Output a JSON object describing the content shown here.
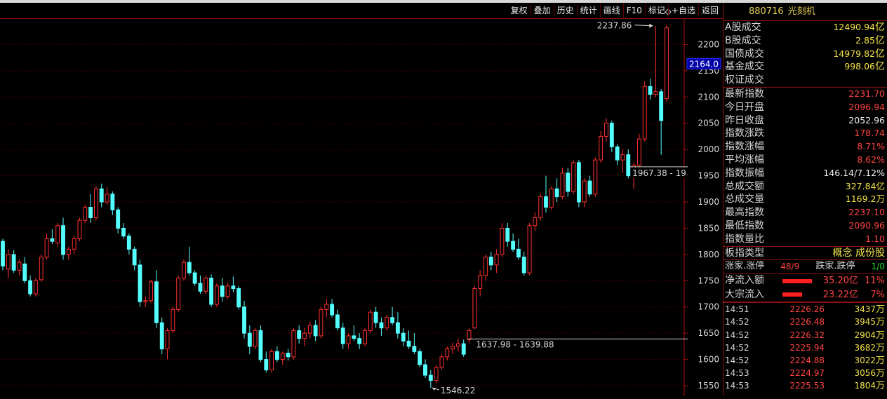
{
  "toolbar": [
    {
      "key": "restore",
      "label": "复权"
    },
    {
      "key": "overlay",
      "label": "叠加"
    },
    {
      "key": "history",
      "label": "历史"
    },
    {
      "key": "stats",
      "label": "统计"
    },
    {
      "key": "draw",
      "label": "画线"
    },
    {
      "key": "f10",
      "label": "F10"
    },
    {
      "key": "mark",
      "label": "标记"
    },
    {
      "key": "watchlist",
      "label": "+自选"
    },
    {
      "key": "back",
      "label": "返回"
    }
  ],
  "axis": {
    "ticks": [
      "2200",
      "2150",
      "2100",
      "2050",
      "2000",
      "1950",
      "1900",
      "1850",
      "1800",
      "1750",
      "1700",
      "1650",
      "1600",
      "1550"
    ],
    "current_price_label": "2164.0"
  },
  "annotations": {
    "high": "2237.86",
    "low": "1546.22",
    "gap_lower": "1637.98 - 1639.88",
    "gap_upper": "1967.38 - 19"
  },
  "colors": {
    "up": "#ff3030",
    "down": "#54ffff",
    "grid": "#7a0000",
    "panel_border": "#8a1010"
  },
  "header": {
    "code": "880716",
    "name": "光刻机"
  },
  "turnover": [
    {
      "label": "A股成交",
      "value": "12490.94",
      "unit": "亿"
    },
    {
      "label": "B股成交",
      "value": "2.85",
      "unit": "亿"
    },
    {
      "label": "国债成交",
      "value": "14979.82",
      "unit": "亿"
    },
    {
      "label": "基金成交",
      "value": "998.06",
      "unit": "亿"
    },
    {
      "label": "权证成交",
      "value": "",
      "unit": ""
    }
  ],
  "stats": [
    {
      "label": "最新指数",
      "value": "2231.70",
      "color": "red"
    },
    {
      "label": "今日开盘",
      "value": "2096.94",
      "color": "red"
    },
    {
      "label": "昨日收盘",
      "value": "2052.96",
      "color": "wht"
    },
    {
      "label": "指数涨跌",
      "value": "178.74",
      "color": "red"
    },
    {
      "label": "指数涨幅",
      "value": "8.71%",
      "color": "red"
    },
    {
      "label": "平均涨幅",
      "value": "8.62%",
      "color": "red"
    },
    {
      "label": "指数振幅",
      "value": "146.14/7.12%",
      "color": "wht"
    },
    {
      "label": "总成交额",
      "value": "327.84亿",
      "color": "yel"
    },
    {
      "label": "总成交量",
      "value": "1169.2万",
      "color": "yel"
    },
    {
      "label": "最高指数",
      "value": "2237.10",
      "color": "red"
    },
    {
      "label": "最低指数",
      "value": "2090.96",
      "color": "red"
    },
    {
      "label": "指数量比",
      "value": "1.10",
      "color": "red"
    }
  ],
  "board": {
    "label": "板指类型",
    "value": "概念 成份股"
  },
  "limits": {
    "up_label": "涨家.涨停",
    "up_value": "48/9",
    "down_label": "跌家.跌停",
    "down_value": "1/0"
  },
  "flows": [
    {
      "label": "净流入额",
      "amount": "35.20亿",
      "pct": "11%",
      "bar_fraction": 0.42
    },
    {
      "label": "大宗流入",
      "amount": "23.22亿",
      "pct": "7%",
      "bar_fraction": 0.28
    }
  ],
  "ticks": [
    {
      "time": "14:51",
      "price": "2226.26",
      "vol": "3437",
      "unit": "万"
    },
    {
      "time": "14:52",
      "price": "2226.48",
      "vol": "3945",
      "unit": "万"
    },
    {
      "time": "14:52",
      "price": "2226.32",
      "vol": "2904",
      "unit": "万"
    },
    {
      "time": "14:52",
      "price": "2225.94",
      "vol": "3682",
      "unit": "万"
    },
    {
      "time": "14:52",
      "price": "2224.88",
      "vol": "3022",
      "unit": "万"
    },
    {
      "time": "14:53",
      "price": "2224.97",
      "vol": "3056",
      "unit": "万"
    },
    {
      "time": "14:53",
      "price": "2225.53",
      "vol": "1804",
      "unit": "万"
    }
  ],
  "chart_data": {
    "type": "candlestick",
    "ylim": [
      1530,
      2250
    ],
    "candles": [
      [
        1825,
        1830,
        1770,
        1778
      ],
      [
        1772,
        1810,
        1755,
        1800
      ],
      [
        1800,
        1808,
        1765,
        1770
      ],
      [
        1770,
        1790,
        1760,
        1785
      ],
      [
        1782,
        1795,
        1745,
        1750
      ],
      [
        1750,
        1760,
        1720,
        1725
      ],
      [
        1725,
        1755,
        1720,
        1750
      ],
      [
        1752,
        1800,
        1748,
        1795
      ],
      [
        1795,
        1840,
        1790,
        1830
      ],
      [
        1830,
        1848,
        1820,
        1825
      ],
      [
        1822,
        1860,
        1815,
        1855
      ],
      [
        1855,
        1870,
        1790,
        1800
      ],
      [
        1800,
        1815,
        1790,
        1810
      ],
      [
        1810,
        1835,
        1800,
        1830
      ],
      [
        1830,
        1870,
        1825,
        1865
      ],
      [
        1865,
        1895,
        1860,
        1890
      ],
      [
        1890,
        1915,
        1860,
        1870
      ],
      [
        1870,
        1930,
        1865,
        1925
      ],
      [
        1925,
        1935,
        1890,
        1900
      ],
      [
        1900,
        1928,
        1895,
        1915
      ],
      [
        1915,
        1920,
        1875,
        1885
      ],
      [
        1885,
        1890,
        1840,
        1850
      ],
      [
        1850,
        1860,
        1830,
        1835
      ],
      [
        1835,
        1840,
        1800,
        1810
      ],
      [
        1810,
        1815,
        1770,
        1780
      ],
      [
        1780,
        1790,
        1700,
        1710
      ],
      [
        1710,
        1720,
        1700,
        1712
      ],
      [
        1712,
        1752,
        1708,
        1748
      ],
      [
        1748,
        1770,
        1660,
        1670
      ],
      [
        1670,
        1680,
        1610,
        1620
      ],
      [
        1620,
        1660,
        1600,
        1655
      ],
      [
        1655,
        1700,
        1650,
        1695
      ],
      [
        1695,
        1760,
        1690,
        1755
      ],
      [
        1755,
        1790,
        1750,
        1785
      ],
      [
        1785,
        1815,
        1760,
        1765
      ],
      [
        1765,
        1770,
        1740,
        1745
      ],
      [
        1745,
        1760,
        1725,
        1730
      ],
      [
        1730,
        1760,
        1725,
        1755
      ],
      [
        1755,
        1762,
        1700,
        1705
      ],
      [
        1705,
        1745,
        1700,
        1740
      ],
      [
        1740,
        1755,
        1710,
        1720
      ],
      [
        1720,
        1745,
        1715,
        1740
      ],
      [
        1740,
        1758,
        1728,
        1735
      ],
      [
        1735,
        1740,
        1695,
        1700
      ],
      [
        1700,
        1712,
        1640,
        1650
      ],
      [
        1650,
        1665,
        1610,
        1625
      ],
      [
        1625,
        1660,
        1620,
        1655
      ],
      [
        1655,
        1665,
        1595,
        1600
      ],
      [
        1600,
        1615,
        1575,
        1580
      ],
      [
        1580,
        1620,
        1575,
        1615
      ],
      [
        1615,
        1625,
        1595,
        1600
      ],
      [
        1600,
        1615,
        1590,
        1612
      ],
      [
        1612,
        1620,
        1598,
        1605
      ],
      [
        1605,
        1660,
        1600,
        1655
      ],
      [
        1655,
        1665,
        1630,
        1640
      ],
      [
        1640,
        1660,
        1625,
        1650
      ],
      [
        1650,
        1672,
        1640,
        1665
      ],
      [
        1665,
        1675,
        1635,
        1645
      ],
      [
        1645,
        1700,
        1640,
        1695
      ],
      [
        1695,
        1715,
        1680,
        1705
      ],
      [
        1705,
        1715,
        1680,
        1685
      ],
      [
        1685,
        1695,
        1655,
        1660
      ],
      [
        1660,
        1670,
        1620,
        1630
      ],
      [
        1630,
        1650,
        1620,
        1645
      ],
      [
        1645,
        1665,
        1635,
        1640
      ],
      [
        1640,
        1650,
        1620,
        1630
      ],
      [
        1630,
        1660,
        1625,
        1655
      ],
      [
        1655,
        1695,
        1650,
        1690
      ],
      [
        1690,
        1700,
        1660,
        1670
      ],
      [
        1670,
        1680,
        1645,
        1660
      ],
      [
        1660,
        1685,
        1655,
        1680
      ],
      [
        1680,
        1700,
        1665,
        1670
      ],
      [
        1670,
        1690,
        1640,
        1650
      ],
      [
        1650,
        1660,
        1625,
        1635
      ],
      [
        1635,
        1655,
        1620,
        1625
      ],
      [
        1625,
        1650,
        1610,
        1615
      ],
      [
        1615,
        1620,
        1585,
        1590
      ],
      [
        1590,
        1600,
        1565,
        1570
      ],
      [
        1570,
        1580,
        1546,
        1560
      ],
      [
        1560,
        1590,
        1555,
        1585
      ],
      [
        1585,
        1610,
        1580,
        1605
      ],
      [
        1605,
        1625,
        1598,
        1620
      ],
      [
        1620,
        1632,
        1610,
        1625
      ],
      [
        1625,
        1640,
        1615,
        1630
      ],
      [
        1630,
        1638,
        1605,
        1610
      ],
      [
        1638,
        1660,
        1632,
        1655
      ],
      [
        1660,
        1740,
        1658,
        1735
      ],
      [
        1735,
        1770,
        1720,
        1760
      ],
      [
        1760,
        1800,
        1750,
        1795
      ],
      [
        1795,
        1805,
        1770,
        1780
      ],
      [
        1780,
        1810,
        1765,
        1800
      ],
      [
        1800,
        1860,
        1795,
        1850
      ],
      [
        1850,
        1860,
        1815,
        1825
      ],
      [
        1825,
        1840,
        1805,
        1810
      ],
      [
        1810,
        1830,
        1790,
        1795
      ],
      [
        1795,
        1805,
        1760,
        1765
      ],
      [
        1765,
        1860,
        1760,
        1855
      ],
      [
        1855,
        1880,
        1845,
        1870
      ],
      [
        1870,
        1915,
        1865,
        1910
      ],
      [
        1910,
        1950,
        1880,
        1890
      ],
      [
        1890,
        1930,
        1885,
        1925
      ],
      [
        1925,
        1945,
        1900,
        1910
      ],
      [
        1910,
        1965,
        1905,
        1955
      ],
      [
        1955,
        1965,
        1910,
        1920
      ],
      [
        1920,
        1980,
        1915,
        1975
      ],
      [
        1975,
        1980,
        1890,
        1900
      ],
      [
        1900,
        1945,
        1890,
        1940
      ],
      [
        1940,
        1950,
        1910,
        1915
      ],
      [
        1915,
        1985,
        1910,
        1980
      ],
      [
        1980,
        2035,
        1975,
        2025
      ],
      [
        2025,
        2060,
        2015,
        2050
      ],
      [
        2050,
        2055,
        1995,
        2005
      ],
      [
        2005,
        2010,
        1970,
        1980
      ],
      [
        1980,
        2000,
        1955,
        1990
      ],
      [
        1990,
        2000,
        1945,
        1950
      ],
      [
        1950,
        1975,
        1925,
        1970
      ],
      [
        1970,
        2030,
        1965,
        2020
      ],
      [
        2020,
        2130,
        2015,
        2120
      ],
      [
        2120,
        2135,
        2095,
        2105
      ],
      [
        2105,
        2235,
        2100,
        2110
      ],
      [
        2110,
        2115,
        1990,
        2055
      ],
      [
        2096.94,
        2237.1,
        2090.96,
        2231.7
      ]
    ]
  }
}
